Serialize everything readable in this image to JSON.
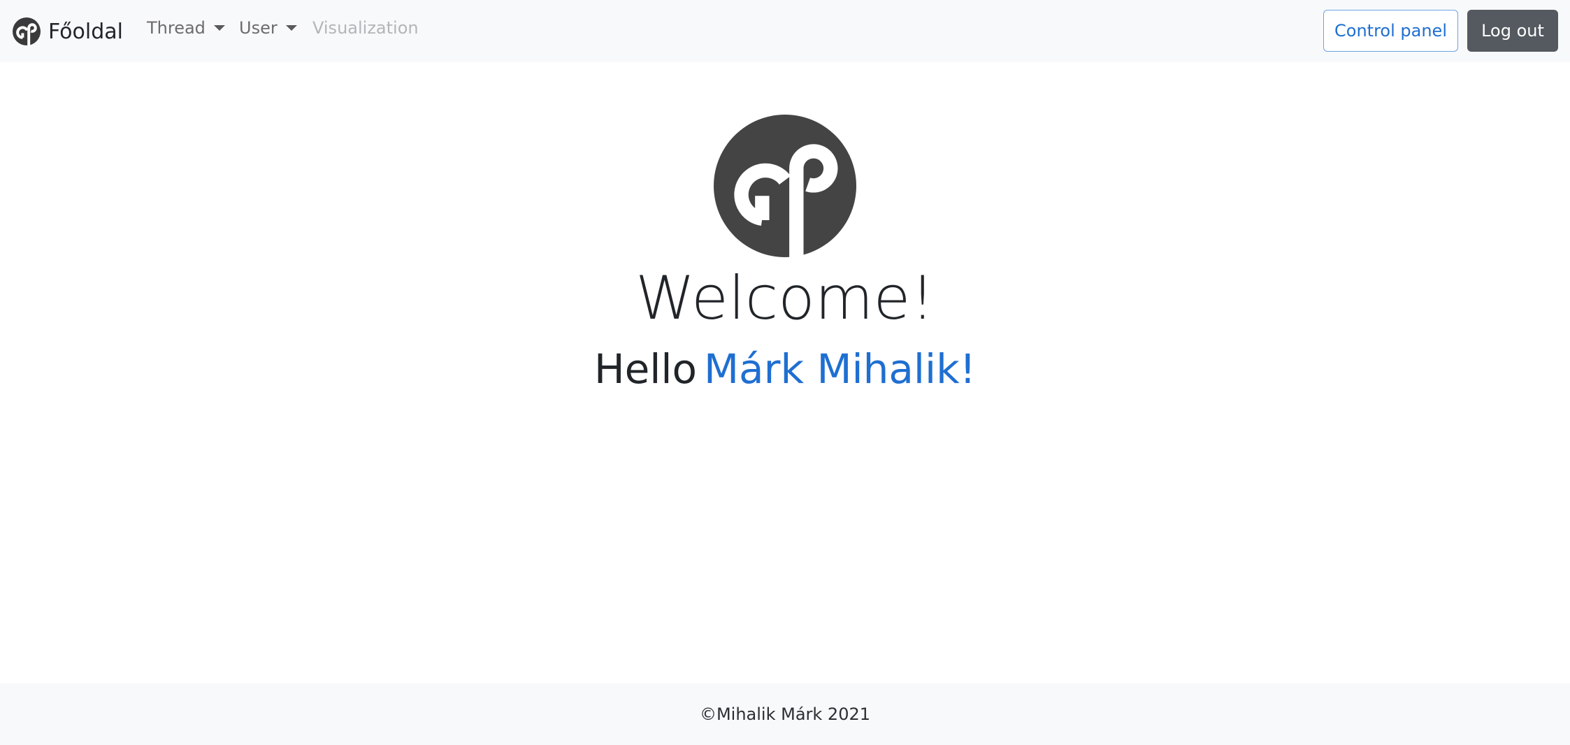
{
  "navbar": {
    "brand_label": "Főoldal",
    "brand_icon": "app-logo-icon",
    "items": [
      {
        "label": "Thread",
        "dropdown": true
      },
      {
        "label": "User",
        "dropdown": true
      },
      {
        "label": "Visualization",
        "disabled": true
      }
    ],
    "control_panel_label": "Control panel",
    "logout_label": "Log out"
  },
  "main": {
    "logo_icon": "app-logo-icon",
    "heading": "Welcome!",
    "greeting": "Hello",
    "user_name": "Márk Mihalik!"
  },
  "footer": {
    "text": "©Mihalik Márk 2021"
  },
  "colors": {
    "navbar_bg": "#f8f9fa",
    "accent": "#1f6fd1",
    "logo_dark": "#444444",
    "logout_bg": "#555a60"
  }
}
